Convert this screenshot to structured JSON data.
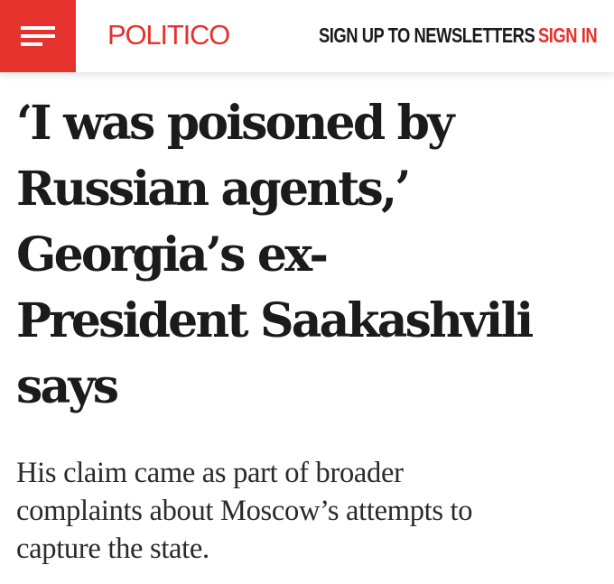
{
  "header": {
    "logo": "POLITICO",
    "newsletters_label": "SIGN UP TO NEWSLETTERS",
    "signin_label": "SIGN IN",
    "menu_icon": "hamburger-menu-icon",
    "accent_color": "#e5322d"
  },
  "article": {
    "headline_lines": [
      "‘I was poisoned by",
      "Russian agents,’",
      "Georgia’s ex-",
      "President Saakashvili",
      "says"
    ],
    "dek_lines": [
      "His claim came as part of broader",
      "complaints about Moscow’s attempts to",
      "capture the state."
    ]
  }
}
